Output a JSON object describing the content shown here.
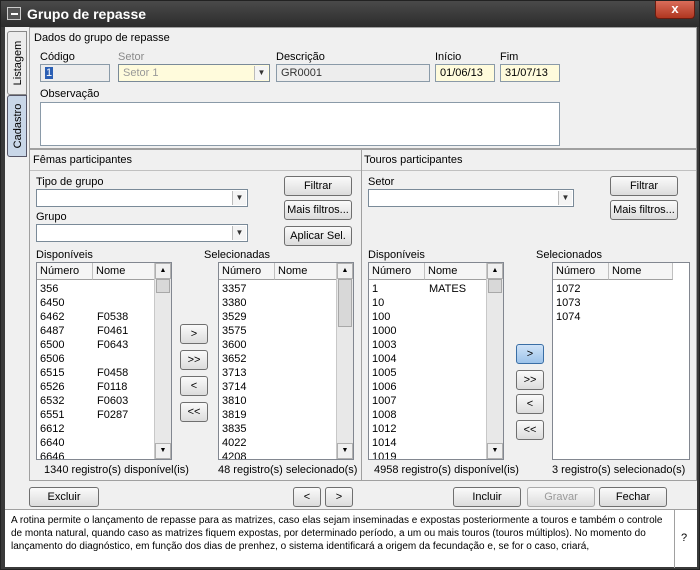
{
  "window": {
    "title": "Grupo de repasse",
    "close": "x"
  },
  "tabs": {
    "listagem": "Listagem",
    "cadastro": "Cadastro"
  },
  "dados": {
    "header": "Dados do grupo de repasse",
    "codigo_label": "Código",
    "codigo_value": "1",
    "setor_label": "Setor",
    "setor_value": "Setor 1",
    "descricao_label": "Descrição",
    "descricao_value": "GR0001",
    "inicio_label": "Início",
    "inicio_value": "01/06/13",
    "fim_label": "Fim",
    "fim_value": "31/07/13",
    "obs_label": "Observação"
  },
  "femeas": {
    "header": "Fêmas participantes",
    "tipo_label": "Tipo de grupo",
    "grupo_label": "Grupo",
    "filtrar": "Filtrar",
    "mais_filtros": "Mais filtros...",
    "aplicar": "Aplicar Sel.",
    "disp_label": "Disponíveis",
    "sel_label": "Selecionadas",
    "col_numero": "Número",
    "col_nome": "Nome",
    "disponiveis": [
      [
        "356",
        ""
      ],
      [
        "6450",
        ""
      ],
      [
        "6462",
        "F0538"
      ],
      [
        "6487",
        "F0461"
      ],
      [
        "6500",
        "F0643"
      ],
      [
        "6506",
        ""
      ],
      [
        "6515",
        "F0458"
      ],
      [
        "6526",
        "F0118"
      ],
      [
        "6532",
        "F0603"
      ],
      [
        "6551",
        "F0287"
      ],
      [
        "6612",
        ""
      ],
      [
        "6640",
        ""
      ],
      [
        "6646",
        ""
      ]
    ],
    "selecionadas": [
      "3357",
      "3380",
      "3529",
      "3575",
      "3600",
      "3652",
      "3713",
      "3714",
      "3810",
      "3819",
      "3835",
      "4022",
      "4208"
    ],
    "btn_add": ">",
    "btn_add_all": ">>",
    "btn_rem": "<",
    "btn_rem_all": "<<",
    "status_disp": "1340 registro(s) disponível(is)",
    "status_sel": "48 registro(s) selecionado(s)"
  },
  "touros": {
    "header": "Touros participantes",
    "setor_label": "Setor",
    "filtrar": "Filtrar",
    "mais_filtros": "Mais filtros...",
    "disp_label": "Disponíveis",
    "sel_label": "Selecionados",
    "col_numero": "Número",
    "col_nome": "Nome",
    "disponiveis": [
      [
        "1",
        "MATES"
      ],
      [
        "10",
        ""
      ],
      [
        "100",
        ""
      ],
      [
        "1000",
        ""
      ],
      [
        "1003",
        ""
      ],
      [
        "1004",
        ""
      ],
      [
        "1005",
        ""
      ],
      [
        "1006",
        ""
      ],
      [
        "1007",
        ""
      ],
      [
        "1008",
        ""
      ],
      [
        "1012",
        ""
      ],
      [
        "1014",
        ""
      ],
      [
        "1019",
        ""
      ]
    ],
    "selecionados": [
      "1072",
      "1073",
      "1074"
    ],
    "btn_add": ">",
    "btn_add_all": ">>",
    "btn_rem": "<",
    "btn_rem_all": "<<",
    "status_disp": "4958 registro(s) disponível(is)",
    "status_sel": "3 registro(s) selecionado(s)"
  },
  "footer": {
    "excluir": "Excluir",
    "prev": "<",
    "next": ">",
    "incluir": "Incluir",
    "gravar": "Gravar",
    "fechar": "Fechar"
  },
  "help": {
    "text": "A rotina permite o lançamento de repasse para as matrizes, caso elas sejam inseminadas e expostas posteriormente a touros e também o controle de monta natural, quando caso as matrizes fiquem expostas, por determinado período, a um ou mais touros (touros múltiplos). No momento do lançamento do diagnóstico, em função dos dias de prenhez, o sistema identificará a origem da fecundação e, se for o caso, criará,",
    "q": "?"
  }
}
